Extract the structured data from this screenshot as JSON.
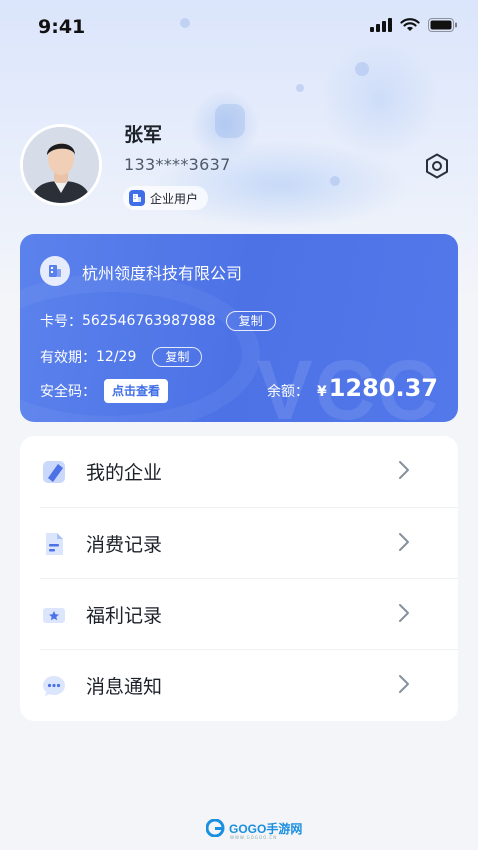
{
  "status_bar": {
    "time": "9:41"
  },
  "user": {
    "name": "张军",
    "phone": "133****3637",
    "badge": "企业用户"
  },
  "card": {
    "company": "杭州领度科技有限公司",
    "card_no_label": "卡号：",
    "card_no": "562546763987988",
    "copy_label": "复制",
    "expiry_label": "有效期：",
    "expiry": "12/29",
    "security_label": "安全码：",
    "view_label": "点击查看",
    "balance_label": "余额：",
    "currency": "¥",
    "balance": "1280.37",
    "watermark": "VCC"
  },
  "menu": {
    "items": [
      {
        "label": "我的企业",
        "icon": "enterprise-icon"
      },
      {
        "label": "消费记录",
        "icon": "document-icon"
      },
      {
        "label": "福利记录",
        "icon": "ticket-icon"
      },
      {
        "label": "消息通知",
        "icon": "message-icon"
      }
    ]
  },
  "footer": {
    "brand": "GOGO手游网",
    "domain": "WWW.GOGOO.CN"
  },
  "colors": {
    "accent": "#4c72e6",
    "background": "#f3f5f9"
  }
}
